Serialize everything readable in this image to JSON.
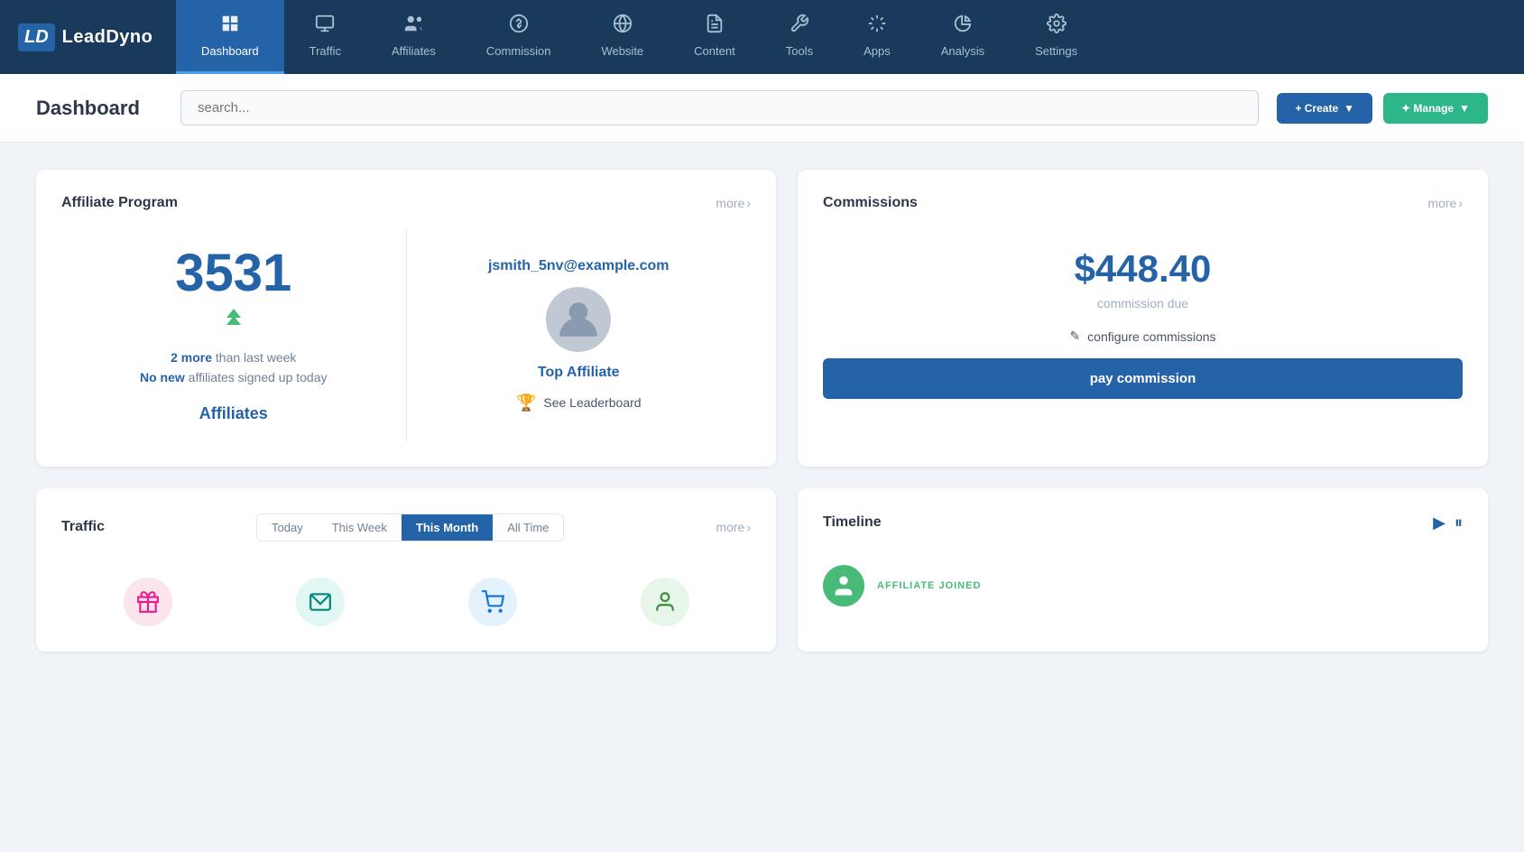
{
  "brand": {
    "logo_letter": "LD",
    "name": "LeadDyno"
  },
  "nav": {
    "items": [
      {
        "id": "dashboard",
        "label": "Dashboard",
        "icon": "⚙️",
        "active": true
      },
      {
        "id": "traffic",
        "label": "Traffic",
        "icon": "🖥️",
        "active": false
      },
      {
        "id": "affiliates",
        "label": "Affiliates",
        "icon": "👥",
        "active": false
      },
      {
        "id": "commission",
        "label": "Commission",
        "icon": "💰",
        "active": false
      },
      {
        "id": "website",
        "label": "Website",
        "icon": "🔗",
        "active": false
      },
      {
        "id": "content",
        "label": "Content",
        "icon": "📄",
        "active": false
      },
      {
        "id": "tools",
        "label": "Tools",
        "icon": "🔧",
        "active": false
      },
      {
        "id": "apps",
        "label": "Apps",
        "icon": "🔌",
        "active": false
      },
      {
        "id": "analysis",
        "label": "Analysis",
        "icon": "📊",
        "active": false
      },
      {
        "id": "settings",
        "label": "Settings",
        "icon": "⚙",
        "active": false
      }
    ]
  },
  "header": {
    "title": "Dashboard",
    "search_placeholder": "search...",
    "create_label": "+ Create",
    "manage_label": "✦ Manage"
  },
  "affiliate_program": {
    "card_title": "Affiliate Program",
    "more_label": "more",
    "count": "3531",
    "more_than_label": "2 more than last week",
    "no_new_label": "No new affiliates signed up today",
    "affiliates_link": "Affiliates",
    "top_email": "jsmith_5nv@example.com",
    "top_affiliate_label": "Top Affiliate",
    "leaderboard_label": "See Leaderboard"
  },
  "commissions": {
    "card_title": "Commissions",
    "more_label": "more",
    "amount": "$448.40",
    "due_label": "commission due",
    "configure_label": "configure commissions",
    "pay_label": "pay commission"
  },
  "traffic": {
    "card_title": "Traffic",
    "more_label": "more",
    "tabs": [
      {
        "id": "today",
        "label": "Today",
        "active": false
      },
      {
        "id": "this-week",
        "label": "This Week",
        "active": false
      },
      {
        "id": "this-month",
        "label": "This Month",
        "active": true
      },
      {
        "id": "all-time",
        "label": "All Time",
        "active": false
      }
    ],
    "icons": [
      {
        "id": "visitors",
        "emoji": "🖱️",
        "color": "pink"
      },
      {
        "id": "email",
        "emoji": "✉️",
        "color": "teal"
      },
      {
        "id": "purchases",
        "emoji": "🛒",
        "color": "blue"
      },
      {
        "id": "affiliates",
        "emoji": "👤",
        "color": "green"
      }
    ]
  },
  "timeline": {
    "card_title": "Timeline",
    "badge": "AFFILIATE JOINED",
    "name": ""
  }
}
